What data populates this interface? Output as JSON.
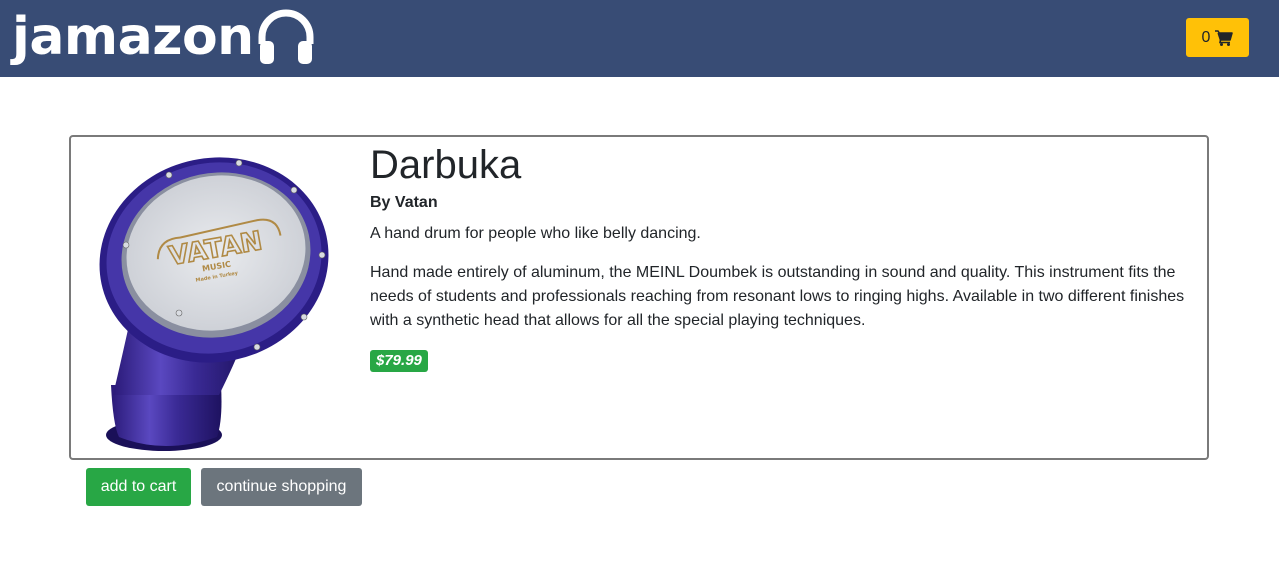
{
  "header": {
    "brand": "jamazon",
    "brand_icon": "headphones-icon",
    "cart_count": "0",
    "cart_icon": "shopping-cart-icon",
    "colors": {
      "navbar": "#384c75",
      "cart_button": "#ffc107"
    }
  },
  "product": {
    "title": "Darbuka",
    "author": "By Vatan",
    "tagline": "A hand drum for people who like belly dancing.",
    "description": "Hand made entirely of aluminum, the MEINL Doumbek is outstanding in sound and quality. This instrument fits the needs of students and professionals reaching from resonant lows to ringing highs. Available in two different finishes with a synthetic head that allows for all the special playing techniques.",
    "price": "$79.99",
    "image": {
      "brand_logo": "VATAN",
      "logo_sub": "MUSIC",
      "logo_sub2": "Made in Turkey"
    }
  },
  "actions": {
    "add_to_cart": "add to cart",
    "continue_shopping": "continue shopping"
  },
  "colors": {
    "success": "#28a745",
    "secondary": "#6c757d"
  }
}
